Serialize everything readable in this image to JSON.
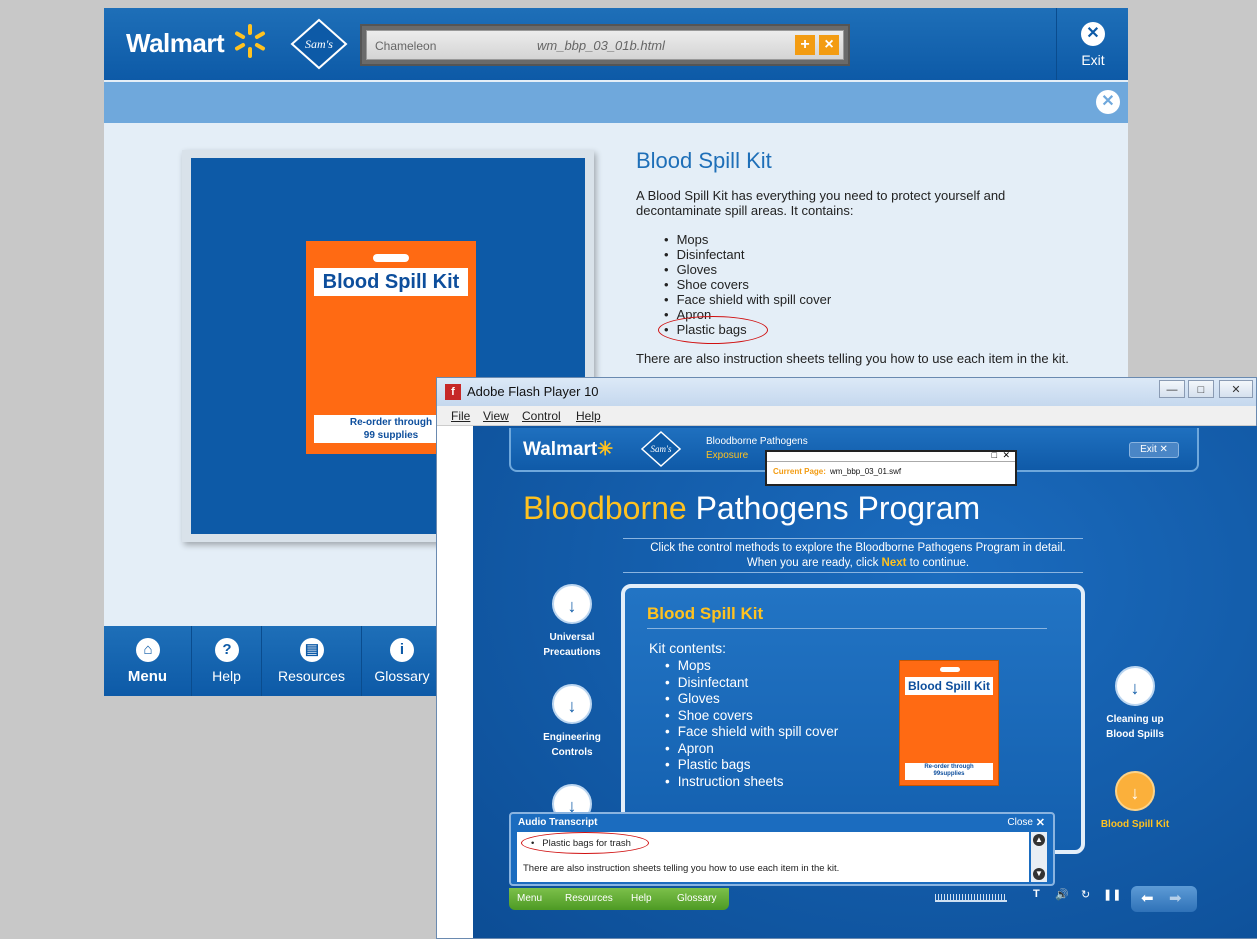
{
  "course": {
    "brand": "Walmart",
    "brand2": "Sam's Club",
    "chameleon": {
      "brand": "Chameleon",
      "file": "wm_bbp_03_01b.html"
    },
    "exit_label": "Exit",
    "content": {
      "title": "Blood Spill Kit",
      "intro": "A Blood Spill Kit has everything you need to protect yourself and decontaminate spill areas.  It contains:",
      "items": [
        "Mops",
        "Disinfectant",
        "Gloves",
        "Shoe covers",
        "Face shield with spill cover",
        "Apron",
        "Plastic bags"
      ],
      "outro": "There are also instruction sheets telling you how to use each item in the kit."
    },
    "kit_card": {
      "label": "Blood Spill Kit",
      "reorder_line1": "Re-order through",
      "reorder_line2": "99 supplies"
    },
    "footer": [
      {
        "label": "Menu",
        "icon": "home-icon"
      },
      {
        "label": "Help",
        "icon": "help-icon"
      },
      {
        "label": "Resources",
        "icon": "resources-icon"
      },
      {
        "label": "Glossary",
        "icon": "info-icon"
      }
    ]
  },
  "flash": {
    "window_title": "Adobe Flash Player 10",
    "menu": [
      "File",
      "View",
      "Control",
      "Help"
    ],
    "header": {
      "brand": "Walmart",
      "course": "Bloodborne Pathogens",
      "sub": "Exposure",
      "exit": "Exit"
    },
    "current_page": {
      "label": "Current Page:",
      "value": "wm_bbp_03_01.swf"
    },
    "title_highlight": "Bloodborne",
    "title_rest": " Pathogens Program",
    "instructions_line1": "Click the control methods to explore the Bloodborne Pathogens Program in detail.",
    "instructions_pre": "When you are ready, click ",
    "instructions_next": "Next",
    "instructions_post": " to continue.",
    "controls_left": [
      {
        "line1": "Universal",
        "line2": "Precautions"
      },
      {
        "line1": "Engineering",
        "line2": "Controls"
      }
    ],
    "controls_right": [
      {
        "line1": "Cleaning up",
        "line2": "Blood Spills"
      },
      {
        "line1": "Blood Spill Kit",
        "line2": ""
      }
    ],
    "panel": {
      "title": "Blood Spill Kit",
      "kit_heading": "Kit contents:",
      "items": [
        "Mops",
        "Disinfectant",
        "Gloves",
        "Shoe covers",
        "Face shield with spill cover",
        "Apron",
        "Plastic bags",
        "Instruction sheets"
      ],
      "card_label": "Blood Spill Kit",
      "card_reorder1": "Re-order through",
      "card_reorder2": "99supplies"
    },
    "transcript": {
      "title": "Audio Transcript",
      "close": "Close",
      "bullet": "Plastic bags for trash",
      "text": "There are also instruction sheets telling you how to use each item in the kit."
    },
    "bottom_nav": [
      "Menu",
      "Resources",
      "Help",
      "Glossary"
    ]
  }
}
